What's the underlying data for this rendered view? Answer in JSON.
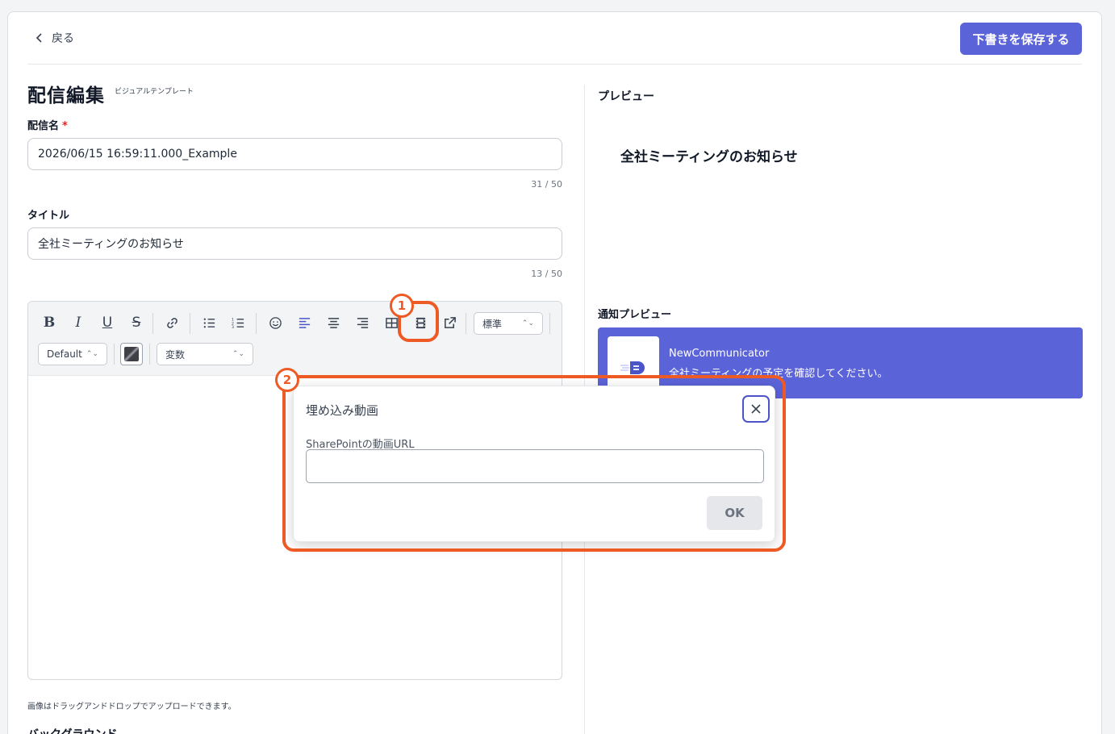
{
  "header": {
    "back_label": "戻る",
    "save_label": "下書きを保存する"
  },
  "editor_page": {
    "title": "配信編集",
    "subtitle": "ビジュアルテンプレート",
    "name_label": "配信名",
    "required_mark": "*",
    "name_value": "2026/06/15 16:59:11.000_Example",
    "name_counter": "31 / 50",
    "title_label": "タイトル",
    "title_value": "全社ミーティングのお知らせ",
    "title_counter": "13 / 50",
    "toolbar": {
      "size_select": "標準",
      "font_select": "Default",
      "variable_select": "変数"
    },
    "hint": "画像はドラッグアンドドロップでアップロードできます。",
    "background_label": "バックグラウンド"
  },
  "preview": {
    "label": "プレビュー",
    "title": "全社ミーティングのお知らせ",
    "notification_label": "通知プレビュー",
    "notification_app": "NewCommunicator",
    "notification_body": "全社ミーティングの予定を確認してください。"
  },
  "dialog": {
    "title": "埋め込み動画",
    "url_label": "SharePointの動画URL",
    "url_value": "",
    "ok_label": "OK"
  },
  "annotations": {
    "badge1": "1",
    "badge2": "2"
  },
  "colors": {
    "accent": "#5b63d8",
    "highlight": "#ee5a24"
  }
}
